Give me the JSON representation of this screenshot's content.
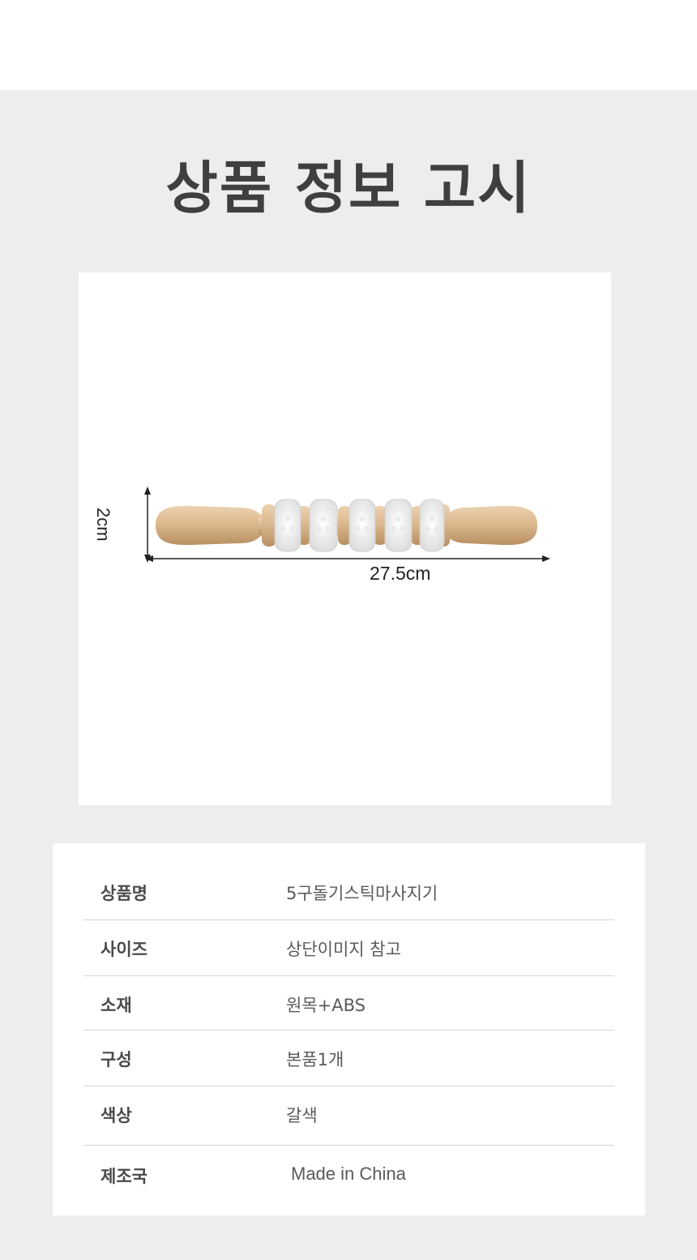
{
  "title": "상품 정보 고시",
  "product_image": {
    "width_label": "27.5cm",
    "height_label": "2cm"
  },
  "info_table": {
    "rows": [
      {
        "label": "상품명",
        "value": "5구돌기스틱마사지기"
      },
      {
        "label": "사이즈",
        "value": "상단이미지 참고"
      },
      {
        "label": "소재",
        "value": "원목+ABS"
      },
      {
        "label": "구성",
        "value": "본품1개"
      },
      {
        "label": "색상",
        "value": "갈색"
      },
      {
        "label": "제조국",
        "value": "Made in China"
      }
    ]
  },
  "colors": {
    "background_panel": "#ededed",
    "title": "#3f3f3f",
    "wood": "#d8b48a",
    "divider": "#dcd6cc"
  }
}
